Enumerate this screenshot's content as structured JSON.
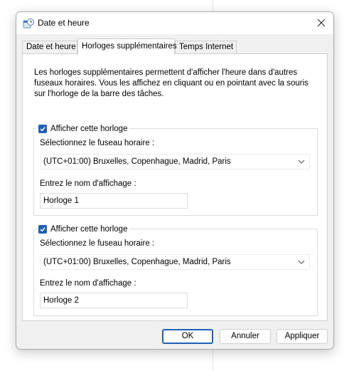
{
  "window": {
    "title": "Date et heure",
    "close_icon": "close-icon",
    "app_icon": "date-time-icon"
  },
  "tabs": [
    {
      "label": "Date et heure",
      "active": false
    },
    {
      "label": "Horloges supplémentaires",
      "active": true
    },
    {
      "label": "Temps Internet",
      "active": false
    }
  ],
  "description": "Les horloges supplémentaires permettent d'afficher l'heure dans d'autres fuseaux horaires. Vous les affichez en cliquant ou en pointant avec la souris sur l'horloge de la barre des tâches.",
  "clocks": [
    {
      "show_label": "Afficher cette horloge",
      "checked": true,
      "timezone_label": "Sélectionnez le fuseau horaire :",
      "timezone_value": "(UTC+01:00) Bruxelles, Copenhague, Madrid, Paris",
      "name_label": "Entrez le nom d'affichage :",
      "name_value": "Horloge 1"
    },
    {
      "show_label": "Afficher cette horloge",
      "checked": true,
      "timezone_label": "Sélectionnez le fuseau horaire :",
      "timezone_value": "(UTC+01:00) Bruxelles, Copenhague, Madrid, Paris",
      "name_label": "Entrez le nom d'affichage :",
      "name_value": "Horloge 2"
    }
  ],
  "buttons": {
    "ok": "OK",
    "cancel": "Annuler",
    "apply": "Appliquer"
  },
  "colors": {
    "accent": "#1f5fb8",
    "dialog_bg": "#f0f0f0",
    "panel_bg": "#ffffff"
  }
}
